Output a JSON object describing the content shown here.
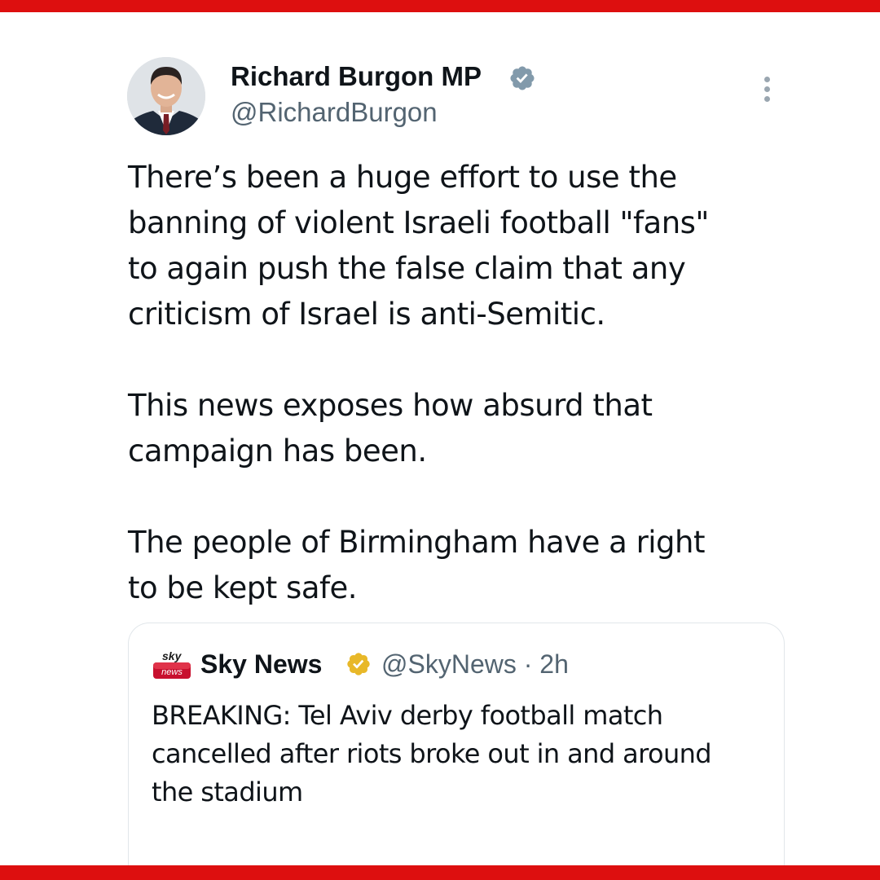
{
  "colors": {
    "frame_red": "#dd0f0f",
    "verified_blue": "#829aab",
    "verified_gold": "#e8b829",
    "secondary_text": "#536471"
  },
  "tweet": {
    "author": {
      "display_name": "Richard Burgon MP",
      "handle": "@RichardBurgon",
      "verified_icon": "verified-badge-icon"
    },
    "paragraphs": [
      "There’s been a huge effort to use the\nbanning of violent Israeli football \"fans\"\nto again push the false claim that any\ncriticism of Israel is anti-Semitic.",
      "This news exposes how absurd that\ncampaign has been.",
      "The people of Birmingham have a right\nto be kept safe."
    ],
    "more_icon": "more-options-icon"
  },
  "quoted_tweet": {
    "logo_top": "sky",
    "logo_bottom": "news",
    "display_name": "Sky News",
    "handle_time": "@SkyNews · 2h",
    "text": "BREAKING: Tel Aviv derby football match\ncancelled after riots broke out in and around\nthe stadium"
  }
}
